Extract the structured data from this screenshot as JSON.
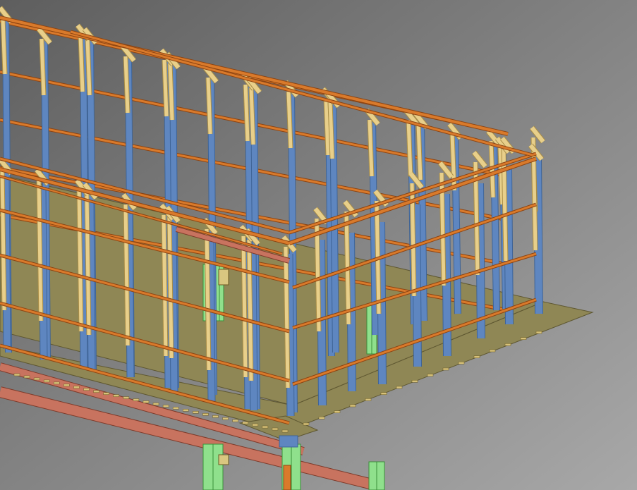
{
  "viewport": {
    "caption": "",
    "background_top": "#5e5e5e",
    "background_bottom": "#a8a8a8"
  },
  "colors": {
    "column_blue": "#5e86c0",
    "column_blue_dark": "#3f6496",
    "brace_tan": "#e8cf8a",
    "brace_tan_dark": "#a88d48",
    "purlin_orange": "#d97a2b",
    "purlin_orange_dark": "#8d4412",
    "beam_red": "#c8735f",
    "beam_red_dark": "#7d3a2a",
    "floor_olive": "#8f8755",
    "floor_olive_dark": "#5e5731",
    "green_column": "#8fe08c",
    "green_column_dark": "#3b8f3a"
  },
  "model": {
    "description_visible": false,
    "element_groups": [
      "steel-columns",
      "diagonal-braces",
      "purlins",
      "floor-plate",
      "ground-beams",
      "support-columns"
    ]
  }
}
